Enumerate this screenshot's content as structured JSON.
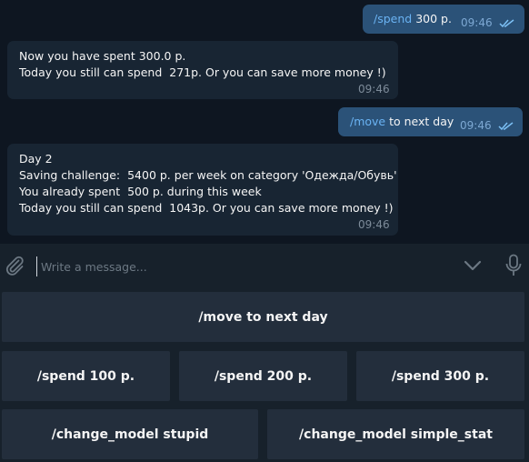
{
  "messages": [
    {
      "command": "/spend",
      "text": " 300 р.",
      "time": "09:46"
    },
    {
      "lines": [
        "Now you have spent 300.0 р.",
        "Today you still can spend  271р. Or you can save more money !)"
      ],
      "time": "09:46"
    },
    {
      "command": "/move",
      "text": " to next day",
      "time": "09:46"
    },
    {
      "lines": [
        "Day 2",
        "Saving challenge:  5400 р. per week on category 'Одежда/Обувь'",
        "You already spent  500 р. during this week",
        "Today you still can spend  1043р. Or you can save more money !)"
      ],
      "time": "09:46"
    }
  ],
  "composer": {
    "placeholder": "Write a message..."
  },
  "keyboard": {
    "row1": [
      "/move to next day"
    ],
    "row2": [
      "/spend 100 р.",
      "/spend 200 р.",
      "/spend 300 р."
    ],
    "row3": [
      "/change_model stupid",
      "/change_model simple_stat"
    ]
  },
  "icons": {
    "attach": "paperclip-icon",
    "keyboard_toggle": "chevron-down-icon",
    "voice": "microphone-icon",
    "read": "double-check-icon"
  },
  "colors": {
    "background": "#0e1621",
    "outgoing_bubble": "#2b5278",
    "incoming_bubble": "#182533",
    "command_link": "#6ab3f3"
  }
}
